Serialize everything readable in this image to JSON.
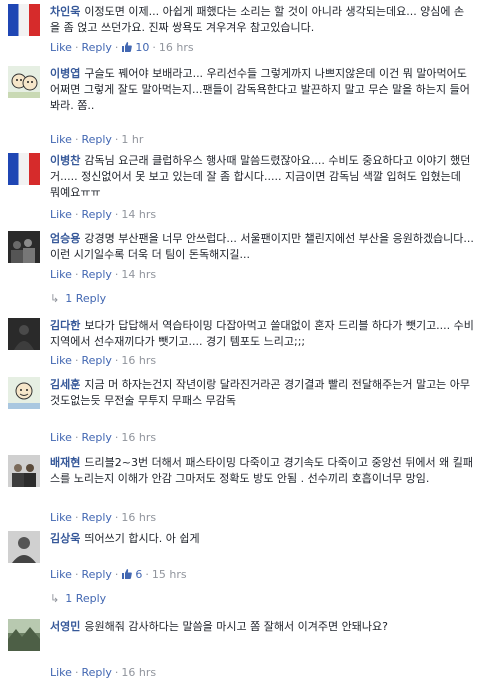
{
  "labels": {
    "like": "Like",
    "reply": "Reply",
    "separator": "·"
  },
  "comments": [
    {
      "author": "차인욱",
      "text": "이정도면 이제... 아쉽게 패했다는 소리는 할 것이 아니라 생각되는데요... 양심에 손을 좀 얹고 쓰던가요. 진짜 쌍욕도 겨우겨우 참고있습니다.",
      "likes": "10",
      "time": "16 hrs"
    },
    {
      "author": "이병엽",
      "text": "구슬도 꿰어야 보배라고... 우리선수들 그렇게까지 나쁘지않은데 이건 뭐 말아먹어도 어쩌면 그렇게 잘도 말아먹는지...팬들이 감독욕한다고 발끈하지 말고 무슨 말을 하는지 들어봐라. 쫌..",
      "likes": "",
      "time": "1 hr"
    },
    {
      "author": "이병찬",
      "text": "감독님 요근래 클럽하우스 행사때 말씀드렸잖아요.... 수비도 중요하다고 이야기 했던거..... 정신없어서 못 보고 있는데 잘 좀 합시다..... 지금이면 감독님 색깔 입혀도 입혔는데 뭐예요ㅠㅠ",
      "likes": "",
      "time": "14 hrs"
    },
    {
      "author": "엄승용",
      "text": "강경명 부산팬을 너무 안쓰럽다... 서울팬이지만 챌린지에선 부산을 응원하겠습니다... 이런 시기일수록 더욱 더 팀이 돈독해지길...",
      "likes": "",
      "time": "14 hrs",
      "replies": "1 Reply"
    },
    {
      "author": "김다한",
      "text": "보다가 답답해서 역습타이밍 다잡아먹고 쓸대없이 혼자 드리블 하다가 뺏기고.... 수비지역에서 선수재끼다가 뺏기고.... 경기 템포도 느리고;;;",
      "likes": "",
      "time": "16 hrs"
    },
    {
      "author": "김세훈",
      "text": "지금 머 하자는건지 작년이랑 달라진거라곤 경기결과 빨리 전달해주는거 말고는 아무것도없는듯 무전술 무투지 무패스 무감독",
      "likes": "",
      "time": "16 hrs"
    },
    {
      "author": "배재현",
      "text": "드리블2~3번 더해서 패스타이밍 다죽이고 경기속도 다죽이고 중앙선 뒤에서 왜 킬패스를 노리는지 이해가 안감 그마저도 정확도 방도 안됨 . 선수끼리 호흡이너무 망임.",
      "likes": "",
      "time": "16 hrs"
    },
    {
      "author": "김상욱",
      "text": "띄어쓰기 합시다. 아 쉽게",
      "likes": "6",
      "time": "15 hrs",
      "replies": "1 Reply"
    },
    {
      "author": "서영민",
      "text": "응원해줘 감사하다는 말씀을 마시고 쫌 잘해서 이겨주면 안돼나요?",
      "likes": "",
      "time": "16 hrs"
    }
  ]
}
